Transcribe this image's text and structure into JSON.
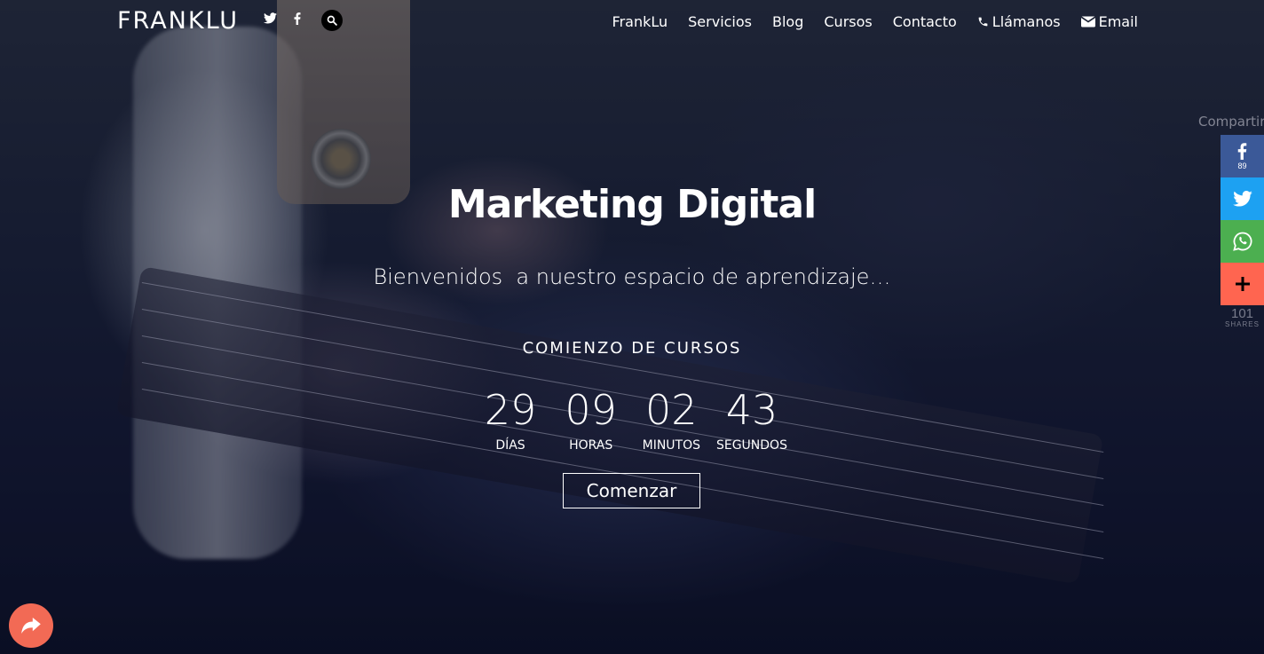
{
  "header": {
    "logo": "FRANKLU",
    "icons": [
      "twitter-icon",
      "facebook-icon",
      "search-icon"
    ],
    "nav": [
      {
        "label": "FrankLu"
      },
      {
        "label": "Servicios"
      },
      {
        "label": "Blog"
      },
      {
        "label": "Cursos"
      },
      {
        "label": "Contacto"
      },
      {
        "label": "Llámanos",
        "icon": "phone-icon"
      },
      {
        "label": "Email",
        "icon": "envelope-icon"
      }
    ]
  },
  "hero": {
    "title": "Marketing Digital",
    "subtitle": "Bienvenidos  a nuestro espacio de aprendizaje…",
    "countdown_heading": "COMIENZO DE CURSOS",
    "countdown": [
      {
        "value": "29",
        "label": "DÍAS"
      },
      {
        "value": "09",
        "label": "HORAS"
      },
      {
        "value": "02",
        "label": "MINUTOS"
      },
      {
        "value": "43",
        "label": "SEGUNDOS"
      }
    ],
    "button_label": "Comenzar"
  },
  "share": {
    "title": "Compartir",
    "buttons": [
      {
        "network": "facebook",
        "icon": "facebook-icon",
        "count": "89",
        "color": "#3b5998"
      },
      {
        "network": "twitter",
        "icon": "twitter-icon",
        "color": "#1da1f2"
      },
      {
        "network": "whatsapp",
        "icon": "whatsapp-icon",
        "color": "#4caf50"
      },
      {
        "network": "more",
        "icon": "plus-icon",
        "color": "#ff6550"
      }
    ],
    "total": "101",
    "total_label": "SHARES"
  },
  "floating_share": {
    "icon": "share-arrow-icon",
    "color": "#f26a55"
  }
}
